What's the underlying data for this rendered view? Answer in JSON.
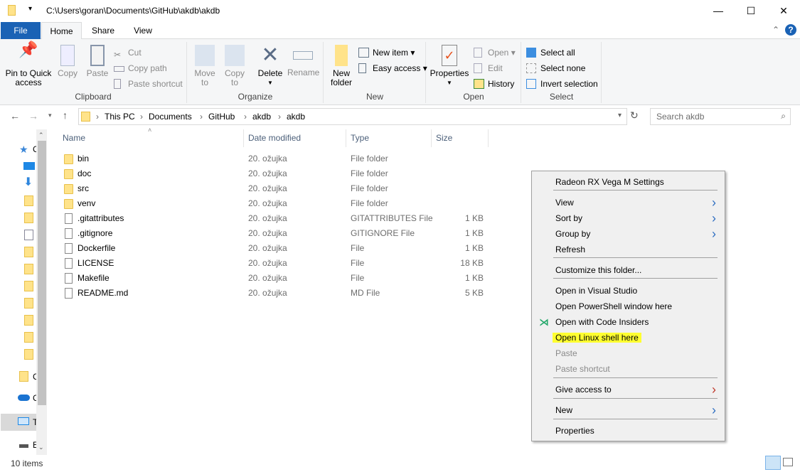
{
  "window": {
    "path": "C:\\Users\\goran\\Documents\\GitHub\\akdb\\akdb",
    "minimize": "—",
    "maximize": "☐",
    "close": "✕"
  },
  "tabs": [
    {
      "label": "File"
    },
    {
      "label": "Home"
    },
    {
      "label": "Share"
    },
    {
      "label": "View"
    }
  ],
  "ribbon": {
    "clipboard": {
      "label": "Clipboard",
      "pin": "Pin to Quick",
      "pin2": "access",
      "copy": "Copy",
      "paste": "Paste",
      "cut": "Cut",
      "copy_path": "Copy path",
      "paste_shortcut": "Paste shortcut"
    },
    "organize": {
      "label": "Organize",
      "move": "Move",
      "move2": "to",
      "copyto": "Copy",
      "copyto2": "to",
      "delete": "Delete",
      "rename": "Rename"
    },
    "new": {
      "label": "New",
      "new_folder": "New",
      "new_folder2": "folder",
      "new_item": "New item ▾",
      "easy_access": "Easy access ▾"
    },
    "open": {
      "label": "Open",
      "properties": "Properties",
      "open": "Open ▾",
      "edit": "Edit",
      "history": "History"
    },
    "select": {
      "label": "Select",
      "select_all": "Select all",
      "select_none": "Select none",
      "invert": "Invert selection"
    }
  },
  "address": {
    "crumbs": [
      "This PC",
      "Documents",
      "GitHub",
      "akdb",
      "akdb"
    ],
    "search_placeholder": "Search akdb"
  },
  "columns": [
    "Name",
    "Date modified",
    "Type",
    "Size"
  ],
  "files": [
    {
      "name": "bin",
      "date": "20. ožujka",
      "type": "File folder",
      "size": "",
      "folder": true
    },
    {
      "name": "doc",
      "date": "20. ožujka",
      "type": "File folder",
      "size": "",
      "folder": true
    },
    {
      "name": "src",
      "date": "20. ožujka",
      "type": "File folder",
      "size": "",
      "folder": true
    },
    {
      "name": "venv",
      "date": "20. ožujka",
      "type": "File folder",
      "size": "",
      "folder": true
    },
    {
      "name": ".gitattributes",
      "date": "20. ožujka",
      "type": "GITATTRIBUTES File",
      "size": "1 KB"
    },
    {
      "name": ".gitignore",
      "date": "20. ožujka",
      "type": "GITIGNORE File",
      "size": "1 KB"
    },
    {
      "name": "Dockerfile",
      "date": "20. ožujka",
      "type": "File",
      "size": "1 KB"
    },
    {
      "name": "LICENSE",
      "date": "20. ožujka",
      "type": "File",
      "size": "18 KB"
    },
    {
      "name": "Makefile",
      "date": "20. ožujka",
      "type": "File",
      "size": "1 KB"
    },
    {
      "name": "README.md",
      "date": "20. ožujka",
      "type": "MD File",
      "size": "5 KB"
    }
  ],
  "sidebar": {
    "quick": "C",
    "cc": "C",
    "onedrive": "C",
    "thispc": "T",
    "drive": "E"
  },
  "status": {
    "count": "10 items"
  },
  "context_menu": {
    "items": [
      {
        "label": "Radeon RX Vega M Settings"
      },
      {
        "label": "View",
        "sub": true
      },
      {
        "label": "Sort by",
        "sub": true
      },
      {
        "label": "Group by",
        "sub": true
      },
      {
        "label": "Refresh"
      },
      {
        "label": "Customize this folder..."
      },
      {
        "label": "Open in Visual Studio"
      },
      {
        "label": "Open PowerShell window here"
      },
      {
        "label": "Open with Code Insiders",
        "icon": "vscode-insiders-icon"
      },
      {
        "label": "Open Linux shell here",
        "highlight": "#ffff30"
      },
      {
        "label": "Paste",
        "disabled": true
      },
      {
        "label": "Paste shortcut",
        "disabled": true
      },
      {
        "label": "Give access to",
        "sub": true
      },
      {
        "label": "New",
        "sub": true
      },
      {
        "label": "Properties"
      }
    ]
  },
  "colors": {
    "file_tab": "#1a62b5",
    "accent": "#0078d7",
    "highlight": "#ffff30"
  }
}
